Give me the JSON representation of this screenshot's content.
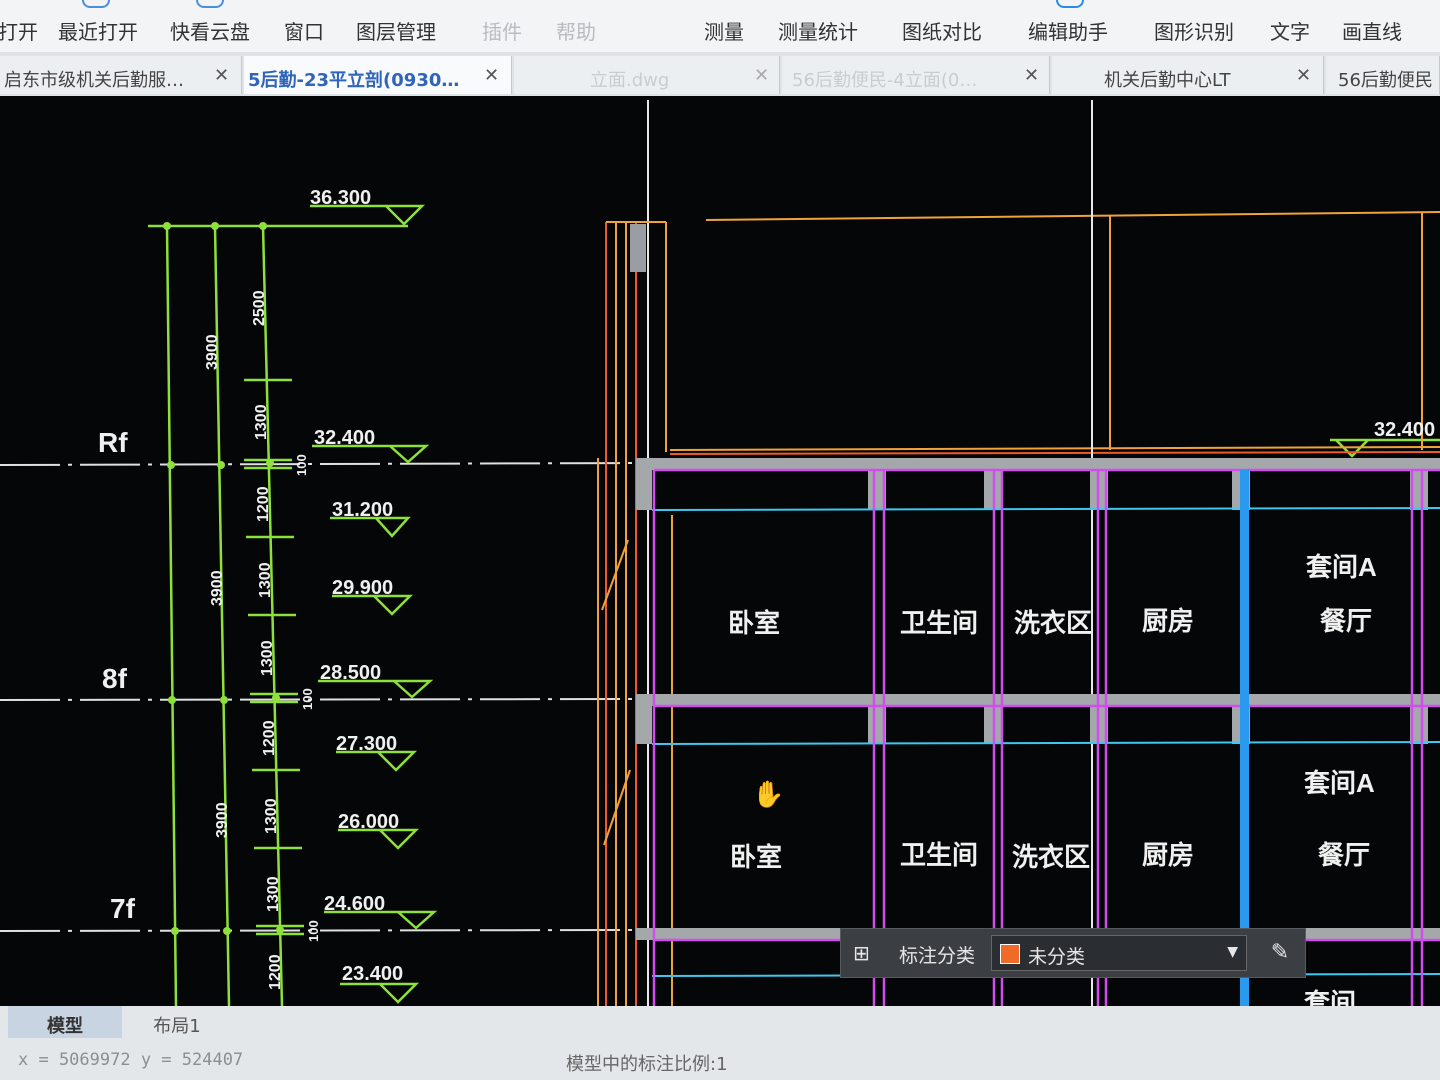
{
  "toolbar": {
    "items": [
      "打开",
      "最近打开",
      "快看云盘",
      "窗口",
      "图层管理",
      "插件",
      "帮助",
      "测量",
      "测量统计",
      "图纸对比",
      "编辑助手",
      "图形识别",
      "文字",
      "画直线"
    ]
  },
  "tabs": [
    {
      "label": "启东市级机关后勤服…"
    },
    {
      "label": "5后勤-23平立剖(0930…"
    },
    {
      "label": "立面.dwg"
    },
    {
      "label": "56后勤便民-4立面(0…"
    },
    {
      "label": "机关后勤中心LT"
    },
    {
      "label": "56后勤便民"
    }
  ],
  "drawing": {
    "floors": [
      "Rf",
      "8f",
      "7f"
    ],
    "elevations": [
      "36.300",
      "32.400",
      "31.200",
      "29.900",
      "28.500",
      "27.300",
      "26.000",
      "24.600",
      "23.400",
      "32.400"
    ],
    "dims_outer": [
      "3900",
      "3900",
      "3900"
    ],
    "dims_inner": [
      "2500",
      "1300",
      "100",
      "1200",
      "1300",
      "1300",
      "100",
      "1200",
      "1300",
      "1300",
      "100",
      "1200"
    ],
    "rooms": [
      "卧室",
      "卫生间",
      "洗衣区",
      "厨房",
      "套间A",
      "餐厅"
    ],
    "next_room_partial": "套间"
  },
  "anno_bar": {
    "label": "标注分类",
    "value": "未分类",
    "swatch_color": "#f06a2a"
  },
  "bottom_tabs": [
    "模型",
    "布局1"
  ],
  "status": {
    "coords": "x = 5069972  y = 524407",
    "scale": "模型中的标注比例:1"
  },
  "colors": {
    "dim_green": "#8ee03a",
    "white": "#e8e8e8",
    "orange": "#f2a23a",
    "red": "#ef5a2a",
    "magenta": "#d24cf0",
    "cyan": "#3cc8f0",
    "blue": "#2a9af0",
    "grey": "#a5a8ab"
  }
}
